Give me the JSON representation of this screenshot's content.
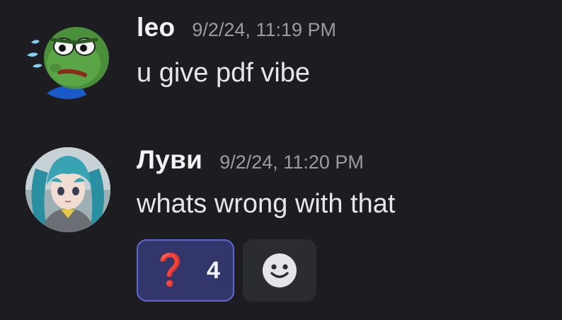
{
  "messages": [
    {
      "username": "leo",
      "timestamp": "9/2/24, 11:19 PM",
      "content": "u give pdf vibe",
      "avatar": "pepe-frog-avatar"
    },
    {
      "username": "Луви",
      "timestamp": "9/2/24, 11:20 PM",
      "content": "whats wrong with that",
      "avatar": "anime-girl-avatar",
      "reactions": [
        {
          "emoji": "❓",
          "emoji_name": "red-question-mark",
          "count": "4"
        }
      ],
      "add_reaction_icon": "smiley-face-icon"
    }
  ],
  "colors": {
    "background": "#1c1c21",
    "reaction_bg": "#33366b",
    "reaction_border": "#6168d6",
    "add_reaction_bg": "#2b2c32",
    "timestamp": "#9a9ca4"
  }
}
